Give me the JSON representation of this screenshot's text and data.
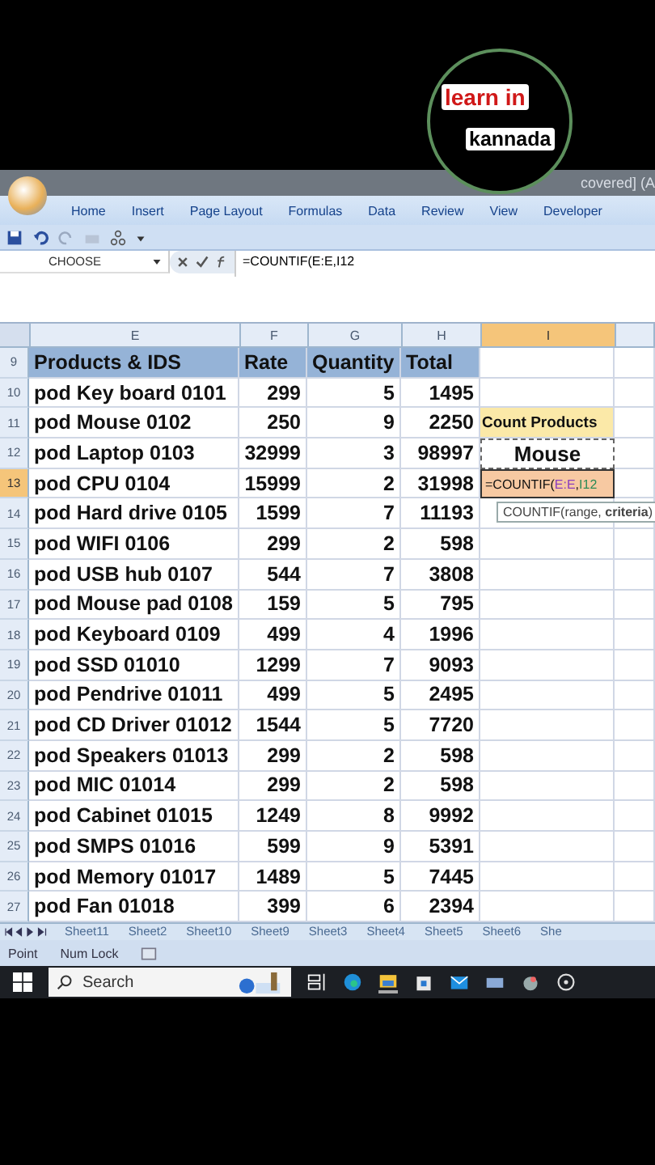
{
  "overlay": {
    "line_1": "learn in",
    "line_2": "kannada"
  },
  "title_bar": {
    "title": "covered] (A"
  },
  "ribbon_tabs": [
    "Home",
    "Insert",
    "Page Layout",
    "Formulas",
    "Data",
    "Review",
    "View",
    "Developer"
  ],
  "formula_bar": {
    "name_box": "CHOOSE",
    "formula": "=COUNTIF(E:E,I12"
  },
  "columns": [
    {
      "label": "E",
      "selected": false
    },
    {
      "label": "F",
      "selected": false
    },
    {
      "label": "G",
      "selected": false
    },
    {
      "label": "H",
      "selected": false
    },
    {
      "label": "I",
      "selected": true
    }
  ],
  "rows": [
    {
      "number": "9",
      "selected": false,
      "kind": "header",
      "cells": [
        "Products & IDS",
        "Rate",
        "Quantity",
        "Total"
      ]
    },
    {
      "number": "10",
      "selected": false,
      "kind": "data",
      "cells": [
        "pod Key board 0101",
        "299",
        "5",
        "1495"
      ]
    },
    {
      "number": "11",
      "selected": false,
      "kind": "data",
      "cells": [
        "pod Mouse 0102",
        "250",
        "9",
        "2250"
      ],
      "side": {
        "kind": "label",
        "text": "Count Products"
      }
    },
    {
      "number": "12",
      "selected": false,
      "kind": "data",
      "cells": [
        "pod Laptop 0103",
        "32999",
        "3",
        "98997"
      ],
      "side": {
        "kind": "criteria",
        "text": "Mouse"
      }
    },
    {
      "number": "13",
      "selected": true,
      "kind": "data",
      "cells": [
        "pod CPU 0104",
        "15999",
        "2",
        "31998"
      ],
      "side": {
        "kind": "editing",
        "parts": [
          {
            "text": "=COUNTIF("
          },
          {
            "text": "E:E",
            "color": "#8a3fbf"
          },
          {
            "text": ","
          },
          {
            "text": "I12",
            "color": "#2e8b57"
          }
        ]
      }
    },
    {
      "number": "14",
      "selected": false,
      "kind": "data",
      "cells": [
        "pod Hard drive 0105",
        "1599",
        "7",
        "11193"
      ],
      "side": {
        "kind": "tooltip",
        "text": "COUNTIF(range, **criteria**)"
      }
    },
    {
      "number": "15",
      "selected": false,
      "kind": "data",
      "cells": [
        "pod WIFI 0106",
        "299",
        "2",
        "598"
      ]
    },
    {
      "number": "16",
      "selected": false,
      "kind": "data",
      "cells": [
        "pod USB hub 0107",
        "544",
        "7",
        "3808"
      ]
    },
    {
      "number": "17",
      "selected": false,
      "kind": "data",
      "cells": [
        "pod Mouse pad 0108",
        "159",
        "5",
        "795"
      ]
    },
    {
      "number": "18",
      "selected": false,
      "kind": "data",
      "cells": [
        "pod Keyboard 0109",
        "499",
        "4",
        "1996"
      ]
    },
    {
      "number": "19",
      "selected": false,
      "kind": "data",
      "cells": [
        "pod SSD 01010",
        "1299",
        "7",
        "9093"
      ]
    },
    {
      "number": "20",
      "selected": false,
      "kind": "data",
      "cells": [
        "pod Pendrive 01011",
        "499",
        "5",
        "2495"
      ]
    },
    {
      "number": "21",
      "selected": false,
      "kind": "data",
      "cells": [
        "pod CD Driver 01012",
        "1544",
        "5",
        "7720"
      ]
    },
    {
      "number": "22",
      "selected": false,
      "kind": "data",
      "cells": [
        "pod Speakers 01013",
        "299",
        "2",
        "598"
      ]
    },
    {
      "number": "23",
      "selected": false,
      "kind": "data",
      "cells": [
        "pod MIC 01014",
        "299",
        "2",
        "598"
      ]
    },
    {
      "number": "24",
      "selected": false,
      "kind": "data",
      "cells": [
        "pod Cabinet 01015",
        "1249",
        "8",
        "9992"
      ]
    },
    {
      "number": "25",
      "selected": false,
      "kind": "data",
      "cells": [
        "pod SMPS 01016",
        "599",
        "9",
        "5391"
      ]
    },
    {
      "number": "26",
      "selected": false,
      "kind": "data",
      "cells": [
        "pod Memory 01017",
        "1489",
        "5",
        "7445"
      ]
    },
    {
      "number": "27",
      "selected": false,
      "kind": "data",
      "cells": [
        "pod Fan 01018",
        "399",
        "6",
        "2394"
      ]
    }
  ],
  "sheet_tabs": [
    "Sheet11",
    "Sheet2",
    "Sheet10",
    "Sheet9",
    "Sheet3",
    "Sheet4",
    "Sheet5",
    "Sheet6",
    "She"
  ],
  "status_bar": [
    "Point",
    "Num Lock"
  ],
  "taskbar": {
    "search_placeholder": "Search"
  }
}
